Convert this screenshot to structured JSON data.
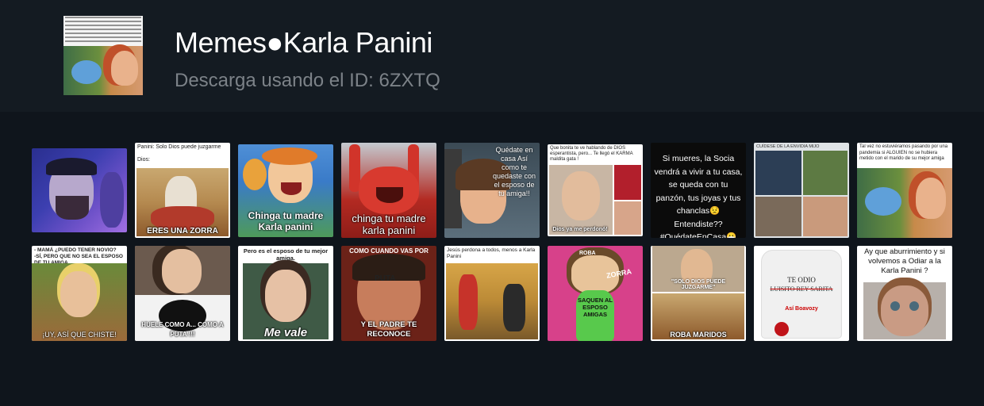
{
  "pack": {
    "title": "Memes●Karla Panini",
    "subtitle": "Descarga usando el ID: 6ZXTQ",
    "thumbnail_icon": "pack-thumbnail"
  },
  "stickers": [
    {
      "id": "s1",
      "caption": ""
    },
    {
      "id": "s2",
      "caption_top": "Panini: Solo Dios puede juzgarme\n\nDios:",
      "caption_bottom": "ERES UNA ZORRA"
    },
    {
      "id": "s3",
      "caption_bottom": "Chinga tu madre Karla panini"
    },
    {
      "id": "s4",
      "caption_bottom": "chinga tu madre karla panini"
    },
    {
      "id": "s5",
      "caption_top": "Quédate en casa Así como te quedaste con el esposo de tu amiga!!"
    },
    {
      "id": "s6",
      "caption_top": "Que bonita te ve hablando de DIOS esperantista, pero... Te llegó el KARMA maldita gata !",
      "caption_bottom": "Dios ya me perdonó!"
    },
    {
      "id": "s7",
      "caption_center": "Si mueres, la Socia vendrá a vivir a tu casa, se queda con tu panzón, tus joyas y tus chanclas😟 Entendiste?? #QuédateEnCasa😷"
    },
    {
      "id": "s8",
      "caption_top": "CUÍDESE DE LA ENVIDIA MIJO"
    },
    {
      "id": "s9",
      "caption_top": "Tal vez no estuviéramos pasando por una pandemia si ALGUIEN no se hubiera metido con el marido de su mejor amiga"
    },
    {
      "id": "s10",
      "caption_top": "- MAMÁ ¿PUEDO TENER NOVIO?\n-SÍ, PERO QUE NO SEA EL ESPOSO DE TU AMIGA.",
      "caption_bottom": "¡UY, ASÍ QUE CHISTE!"
    },
    {
      "id": "s11",
      "caption_bottom": "HUELE COMO A... COMO A PUTA !!!"
    },
    {
      "id": "s12",
      "caption_top": "Pero es el esposo de tu mejor amiga.",
      "caption_bottom": "Me vale"
    },
    {
      "id": "s13",
      "caption_top": "COMO CUANDO VAS POR CENIZA",
      "caption_bottom": "Y EL PADRE TE RECONOCE",
      "caption_mid": "PUTA"
    },
    {
      "id": "s14",
      "caption_top": "Jesús perdona a todos, menos a Karla Panini"
    },
    {
      "id": "s15",
      "caption_bottom": "SAQUEN AL ESPOSO AMIGAS",
      "caption_mid": "ZORRA",
      "caption_top": "ROBA"
    },
    {
      "id": "s16",
      "caption_top": "\"SOLO DIOS PUEDE JUZGARME\"",
      "caption_bottom": "ROBA MARIDOS"
    },
    {
      "id": "s17",
      "caption_top": "TE ODIO",
      "caption_mid": "LUISITO REY SARITA",
      "caption_bottom": "Así Boavozy"
    },
    {
      "id": "s18",
      "caption_top": "Ay que aburrimiento y si volvemos a Odiar a la Karla Panini ?"
    }
  ]
}
